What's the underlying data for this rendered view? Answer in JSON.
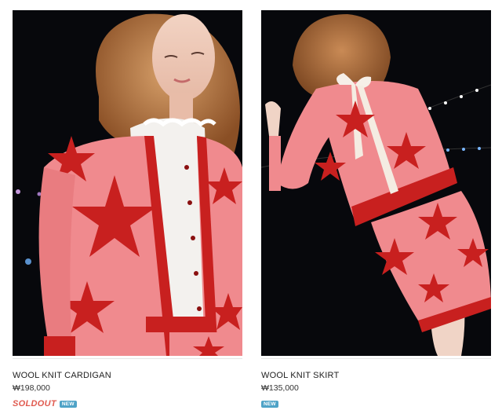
{
  "products": [
    {
      "name": "WOOL KNIT CARDIGAN",
      "price": "₩198,000",
      "soldout_label": "SOLDOUT",
      "new_label": "NEW",
      "image_icon": "cardigan-photo"
    },
    {
      "name": "WOOL KNIT SKIRT",
      "price": "₩135,000",
      "new_label": "NEW",
      "image_icon": "skirt-photo"
    }
  ],
  "colors": {
    "soldout": "#e05a4f",
    "new_badge": "#4fa3c7",
    "knit_pink": "#f08a8e",
    "knit_red": "#c8201f",
    "background_dark": "#07080c"
  }
}
